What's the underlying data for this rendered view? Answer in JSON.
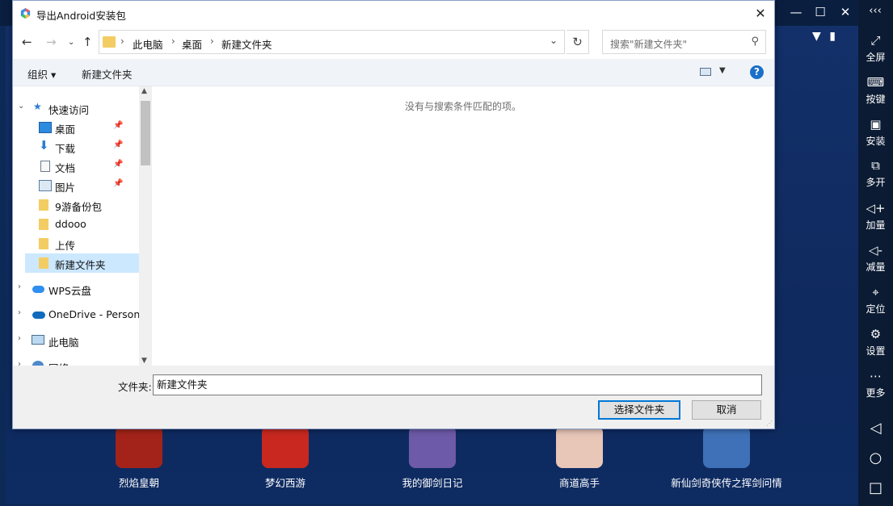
{
  "dialog": {
    "title": "导出Android安装包",
    "close_glyph": "✕",
    "address": {
      "crumbs": [
        "此电脑",
        "桌面",
        "新建文件夹"
      ],
      "search_placeholder": "搜索\"新建文件夹\""
    },
    "toolbar": {
      "organize": "组织 ▾",
      "new_folder": "新建文件夹",
      "help": "?"
    },
    "nav": {
      "quick_access": "快速访问",
      "items": [
        {
          "label": "桌面"
        },
        {
          "label": "下载"
        },
        {
          "label": "文档"
        },
        {
          "label": "图片"
        },
        {
          "label": "9游备份包"
        },
        {
          "label": "ddooo"
        },
        {
          "label": "上传"
        },
        {
          "label": "新建文件夹"
        }
      ],
      "wps": "WPS云盘",
      "onedrive": "OneDrive - Personal",
      "this_pc": "此电脑",
      "network": "网络"
    },
    "content": {
      "empty_message": "没有与搜索条件匹配的项。"
    },
    "footer": {
      "folder_label": "文件夹:",
      "folder_value": "新建文件夹",
      "select_button": "选择文件夹",
      "cancel_button": "取消"
    }
  },
  "emulator": {
    "sidebar": [
      {
        "icon": "fullscreen-icon",
        "label": "全屏"
      },
      {
        "icon": "keyboard-icon",
        "label": "按键"
      },
      {
        "icon": "apk-icon",
        "label": "安装"
      },
      {
        "icon": "multi-instance-icon",
        "label": "多开"
      },
      {
        "icon": "volume-up-icon",
        "label": "加量"
      },
      {
        "icon": "volume-down-icon",
        "label": "减量"
      },
      {
        "icon": "location-icon",
        "label": "定位"
      },
      {
        "icon": "gear-icon",
        "label": "设置"
      },
      {
        "icon": "more-icon",
        "label": "更多"
      }
    ],
    "apps": [
      {
        "label": "烈焰皇朝",
        "color": "#a3231a"
      },
      {
        "label": "梦幻西游",
        "color": "#c8281f"
      },
      {
        "label": "我的御剑日记",
        "color": "#6d5aa8"
      },
      {
        "label": "商道高手",
        "color": "#e8c6b8"
      },
      {
        "label": "新仙剑奇侠传之挥剑问情",
        "color": "#3f71b8"
      }
    ]
  },
  "colors": {
    "accent": "#0078d7",
    "selection": "#cce8ff",
    "folder": "#f3cd63"
  }
}
